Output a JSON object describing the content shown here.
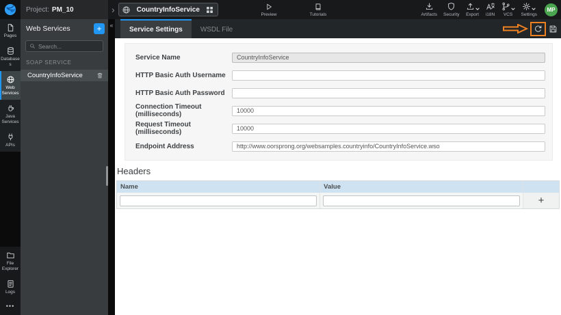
{
  "colors": {
    "accent_blue": "#2296f3",
    "annotation_orange": "#f08121",
    "avatar_green": "#4ba450",
    "table_header_blue": "#cfe2f1"
  },
  "topbar": {
    "project_label": "Project:",
    "project_name": "PM_10",
    "breadcrumb_chevron": "›",
    "service_chip": {
      "label": "CountryInfoService"
    },
    "center_items": [
      {
        "label": "Preview"
      },
      {
        "label": "Tutorials"
      }
    ],
    "right_items": [
      {
        "label": "Artifacts"
      },
      {
        "label": "Security"
      },
      {
        "label": "Export"
      },
      {
        "label": "i18N"
      },
      {
        "label": "VCS"
      },
      {
        "label": "Settings"
      }
    ],
    "avatar_initials": "MP"
  },
  "rail": {
    "items": [
      {
        "label": "Pages"
      },
      {
        "label": "Databases"
      },
      {
        "label": "Web Services"
      },
      {
        "label": "Java Services"
      },
      {
        "label": "APIs"
      }
    ],
    "bottom_items": [
      {
        "label": "File Explorer"
      },
      {
        "label": "Logs"
      }
    ],
    "more_label": "•••"
  },
  "panel": {
    "title": "Web Services",
    "add_button": "+",
    "search_placeholder": "Search...",
    "search_value": "",
    "section_label": "SOAP SERVICE",
    "items": [
      {
        "label": "CountryInfoService"
      }
    ],
    "collapse_glyph": "«"
  },
  "tabs": [
    {
      "label": "Service Settings"
    },
    {
      "label": "WSDL File"
    }
  ],
  "form": {
    "fields": [
      {
        "label": "Service Name",
        "value": "CountryInfoService"
      },
      {
        "label": "HTTP Basic Auth Username",
        "value": ""
      },
      {
        "label": "HTTP Basic Auth Password",
        "value": ""
      },
      {
        "label": "Connection Timeout (milliseconds)",
        "value": "10000"
      },
      {
        "label": "Request Timeout (milliseconds)",
        "value": "10000"
      },
      {
        "label": "Endpoint Address",
        "value": "http://www.oorsprong.org/websamples.countryinfo/CountryInfoService.wso"
      }
    ]
  },
  "headers_section": {
    "title": "Headers",
    "columns": [
      {
        "label": "Name"
      },
      {
        "label": "Value"
      }
    ],
    "row": {
      "name_value": "",
      "value_value": ""
    },
    "add_label": "+"
  }
}
